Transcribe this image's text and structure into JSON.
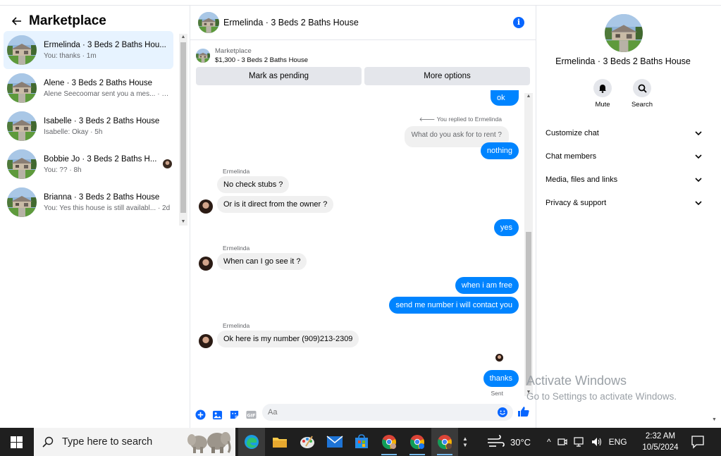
{
  "sidebar": {
    "title": "Marketplace",
    "conversations": [
      {
        "name": "Ermelinda · 3 Beds 2 Baths Hou...",
        "preview": "You: thanks · 1m"
      },
      {
        "name": "Alene · 3 Beds 2 Baths House",
        "preview": "Alene Seecoomar sent you a mes... · 5m"
      },
      {
        "name": "Isabelle · 3 Beds 2 Baths House",
        "preview": "Isabelle: Okay · 5h"
      },
      {
        "name": "Bobbie Jo · 3 Beds 2 Baths H...",
        "preview": "You: ?? · 8h"
      },
      {
        "name": "Brianna · 3 Beds 2 Baths House",
        "preview": "You: Yes this house is still availabl... · 2d"
      }
    ]
  },
  "chat": {
    "title": "Ermelinda · 3 Beds 2 Baths House",
    "marketplace_label": "Marketplace",
    "listing": "$1,300 - 3 Beds 2 Baths House",
    "mark_pending": "Mark as pending",
    "more_options": "More options",
    "messages": {
      "ok": "ok",
      "reply_note": "You replied to Ermelinda",
      "quoted": "What do you ask for to rent ?",
      "nothing": "nothing",
      "sender1": "Ermelinda",
      "no_check_stubs": "No check stubs ?",
      "direct_owner": "Or is it direct from the owner ?",
      "yes": "yes",
      "sender2": "Ermelinda",
      "when_see": "When can I go see it ?",
      "when_free": "when i am free",
      "send_number": "send me number i will contact you",
      "sender3": "Ermelinda",
      "number": "Ok here is my number (909)213-2309",
      "thanks": "thanks",
      "sent": "Sent"
    },
    "composer_placeholder": "Aa"
  },
  "right_panel": {
    "name": "Ermelinda · 3 Beds 2 Baths House",
    "mute": "Mute",
    "search": "Search",
    "sections": [
      "Customize chat",
      "Chat members",
      "Media, files and links",
      "Privacy & support"
    ]
  },
  "watermark": {
    "line1": "Activate Windows",
    "line2": "Go to Settings to activate Windows."
  },
  "taskbar": {
    "search_placeholder": "Type here to search",
    "weather": "30°C",
    "language": "ENG",
    "time": "2:32 AM",
    "date": "10/5/2024"
  },
  "colors": {
    "messenger_blue": "#0084ff",
    "accent": "#0866ff",
    "active_row": "#e7f3ff"
  }
}
